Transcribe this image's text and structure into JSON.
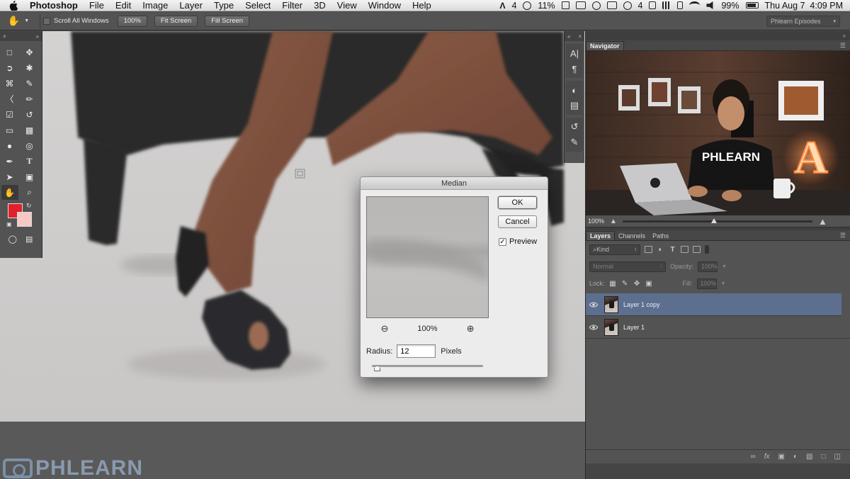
{
  "menubar": {
    "app_name": "Photoshop",
    "menus": [
      "File",
      "Edit",
      "Image",
      "Layer",
      "Type",
      "Select",
      "Filter",
      "3D",
      "View",
      "Window",
      "Help"
    ],
    "status_adobe_count": "4",
    "status_percent": "11%",
    "status_notify_count": "4",
    "battery": "99%",
    "datetime": "Thu Aug 7  4:09 PM"
  },
  "options": {
    "scroll_all_windows": "Scroll All Windows",
    "btn_100": "100%",
    "btn_fit": "Fit Screen",
    "btn_fill": "Fill Screen",
    "workspace": "Phlearn Episodes"
  },
  "colors": {
    "foreground": "#e0202a",
    "background": "#f7c8c4",
    "selection": "#5d6f8f"
  },
  "navigator": {
    "tab": "Navigator",
    "zoom": "100%",
    "preview_text": "PHLEARN",
    "letter": "A"
  },
  "layers_panel": {
    "tabs": [
      "Layers",
      "Channels",
      "Paths"
    ],
    "kind": "Kind",
    "blend_mode": "Normal",
    "opacity_label": "Opacity:",
    "opacity_value": "100%",
    "lock_label": "Lock:",
    "fill_label": "Fill:",
    "fill_value": "100%",
    "layers": [
      {
        "name": "Layer 1 copy",
        "selected": true,
        "visible": true
      },
      {
        "name": "Layer 1",
        "selected": false,
        "visible": true
      }
    ]
  },
  "dialog": {
    "title": "Median",
    "ok": "OK",
    "cancel": "Cancel",
    "preview_label": "Preview",
    "preview_checked": true,
    "zoom": "100%",
    "radius_label": "Radius:",
    "radius_value": "12",
    "radius_unit": "Pixels",
    "radius_fraction": 0.02
  },
  "watermark": "PHLEARN",
  "icons": {
    "tools": [
      "marquee-icon",
      "move-icon",
      "lasso-icon",
      "magic-wand-icon",
      "crop-icon",
      "eyedropper-icon",
      "healing-brush-icon",
      "brush-icon",
      "stamp-icon",
      "history-brush-icon",
      "eraser-icon",
      "gradient-icon",
      "blur-icon",
      "dodge-icon",
      "pen-icon",
      "type-icon",
      "path-select-icon",
      "shape-icon",
      "hand-icon",
      "zoom-icon"
    ]
  }
}
